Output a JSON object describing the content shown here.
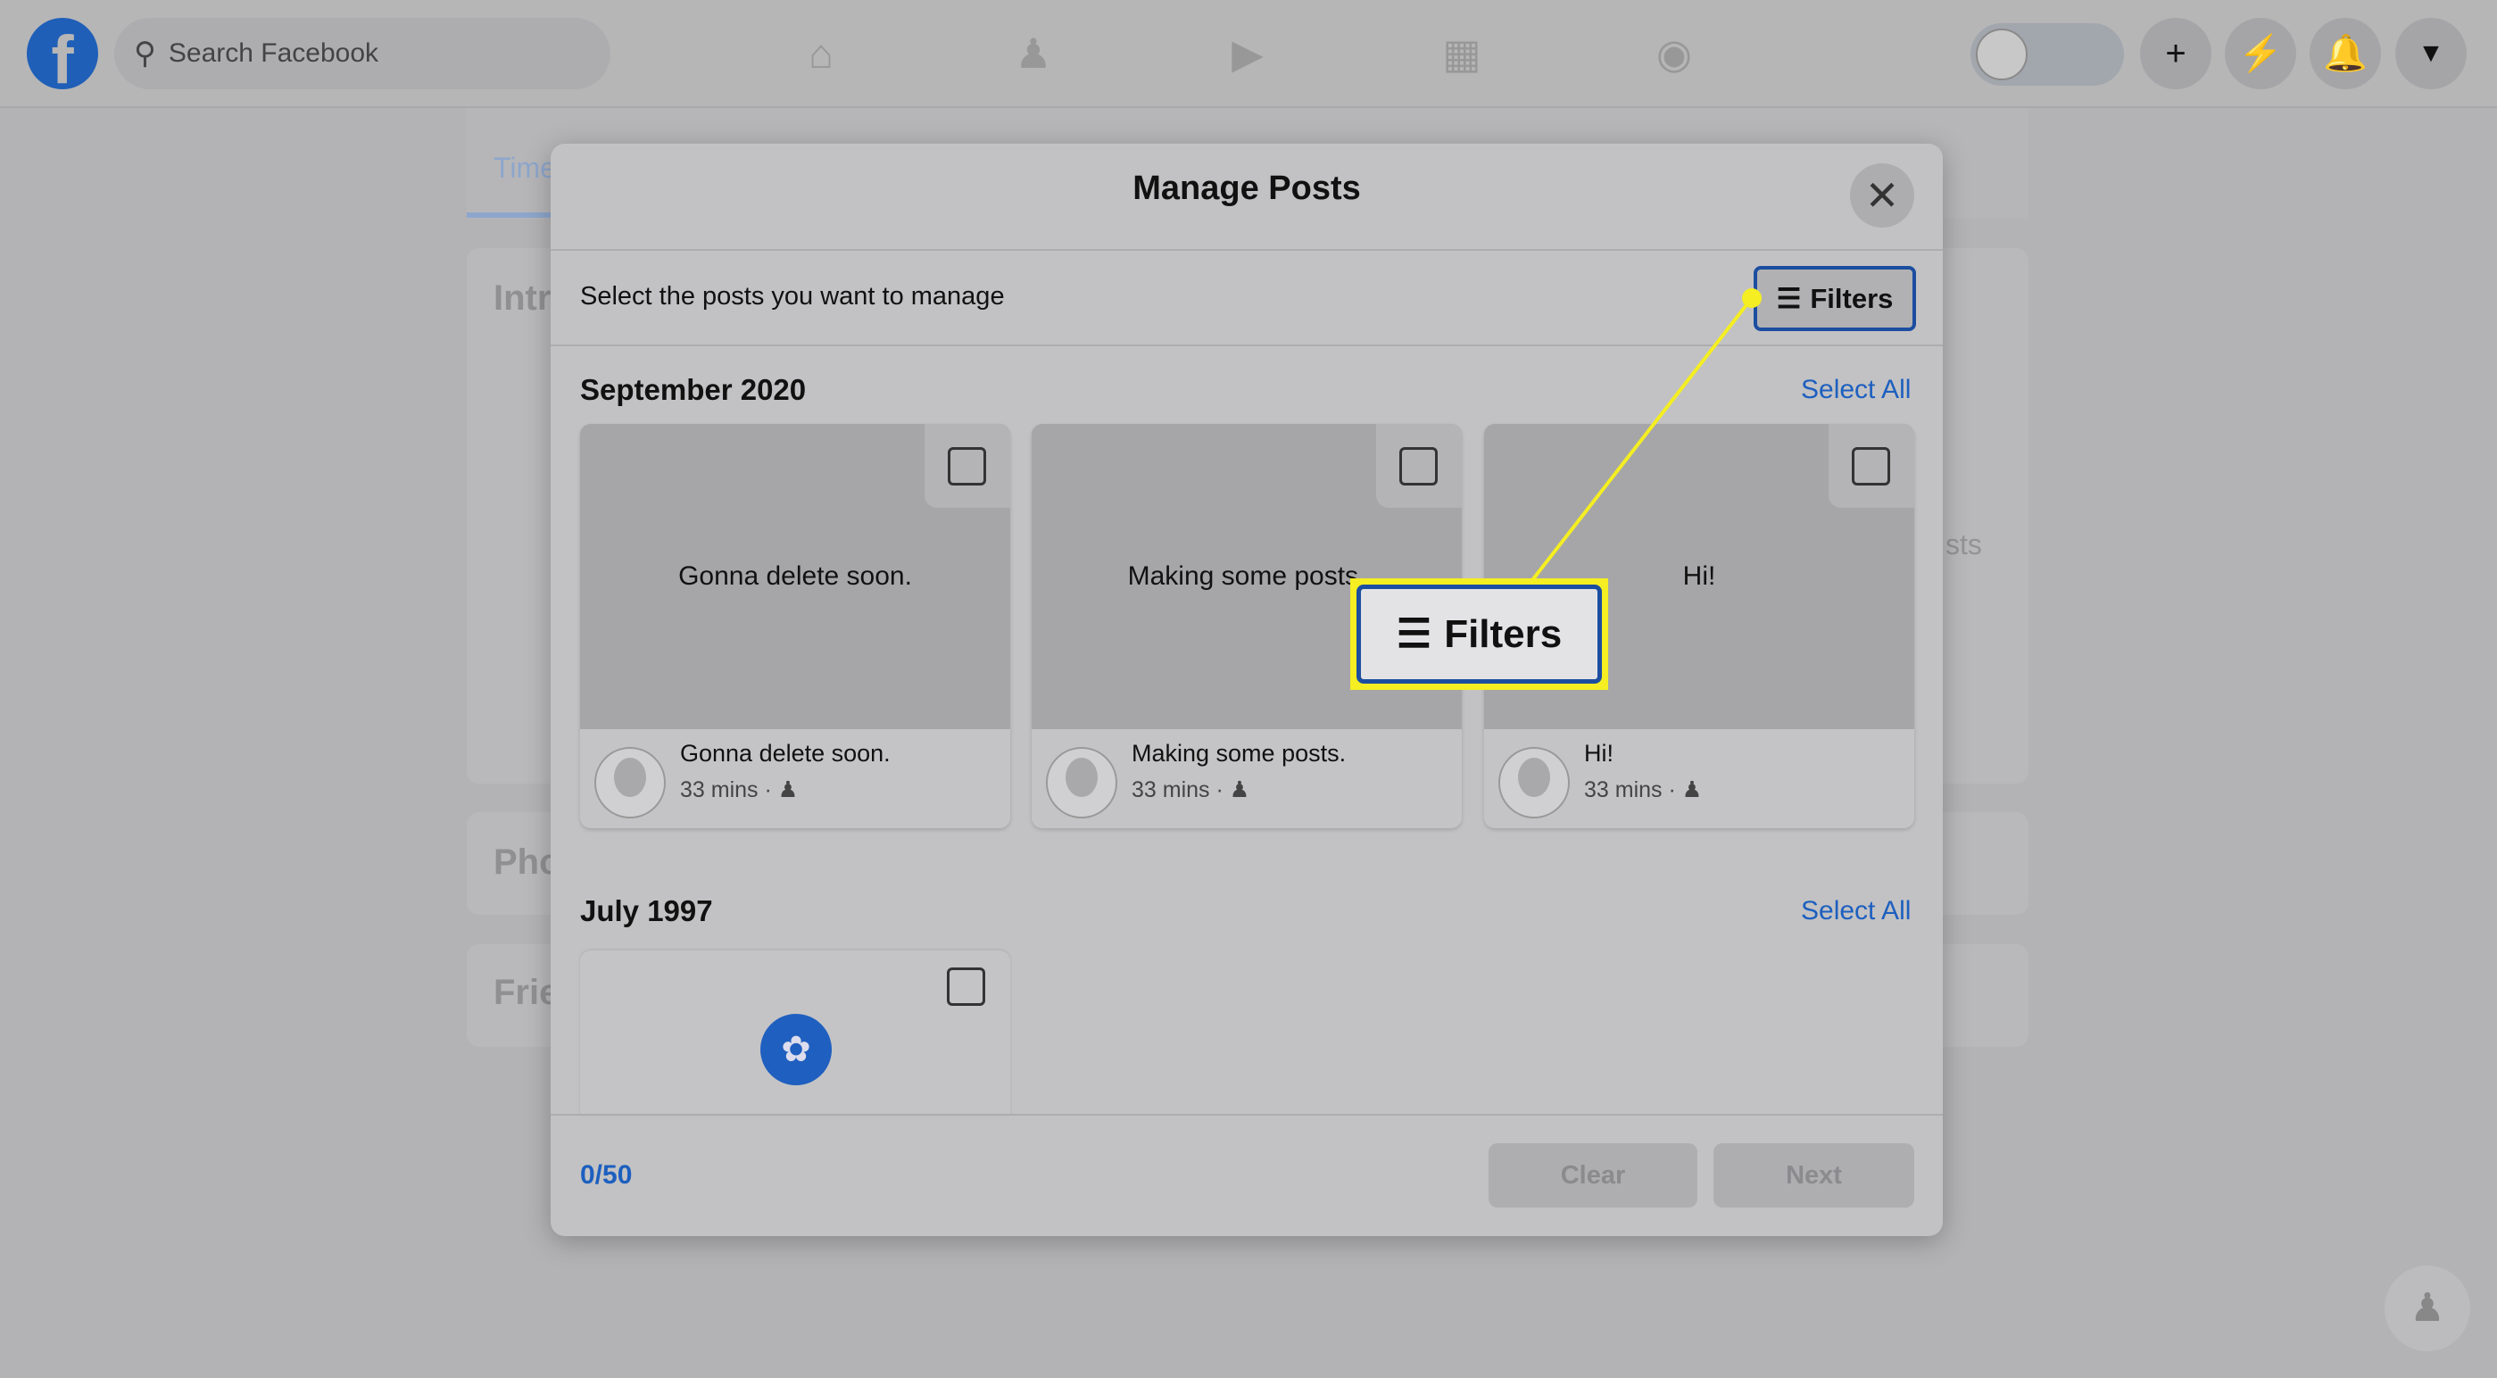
{
  "nav": {
    "search_placeholder": "Search Facebook",
    "icons": [
      "home-icon",
      "friends-icon",
      "watch-icon",
      "marketplace-icon",
      "groups-icon"
    ],
    "right_icons": [
      "plus-icon",
      "messenger-icon",
      "bell-icon",
      "caret-down-icon"
    ]
  },
  "background": {
    "tab": "Time",
    "intro": "Intr",
    "photos": "Pho",
    "friends": "Frie",
    "posts_fragment": "sts"
  },
  "modal": {
    "title": "Manage Posts",
    "subtitle": "Select the posts you want to manage",
    "filters_label": "Filters",
    "sections": [
      {
        "heading": "September 2020",
        "select_all": "Select All",
        "posts": [
          {
            "preview": "Gonna delete soon.",
            "text": "Gonna delete soon.",
            "time": "33 mins ·"
          },
          {
            "preview": "Making some posts.",
            "text": "Making some posts.",
            "time": "33 mins ·"
          },
          {
            "preview": "Hi!",
            "text": "Hi!",
            "time": "33 mins ·"
          }
        ]
      },
      {
        "heading": "July 1997",
        "select_all": "Select All"
      }
    ],
    "count": "0/50",
    "clear_label": "Clear",
    "next_label": "Next"
  },
  "callout": {
    "label": "Filters",
    "color": "#f4ee22"
  },
  "colors": {
    "accent": "#1d5fbf",
    "highlight": "#f4ee22"
  }
}
